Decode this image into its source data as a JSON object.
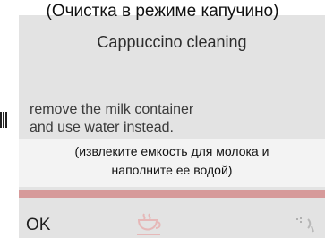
{
  "caption_ru_title": "(Очистка в режиме капучино)",
  "screen": {
    "title": "Cappuccino cleaning",
    "instruction_lines": [
      "remove the milk container",
      "and use water instead."
    ],
    "translation_lines": [
      "(извлеките емкость для молока и",
      "наполните ее водой)"
    ],
    "ok_label": "OK"
  },
  "icons": {
    "center": "cup-icon",
    "right": "steam-icon"
  }
}
